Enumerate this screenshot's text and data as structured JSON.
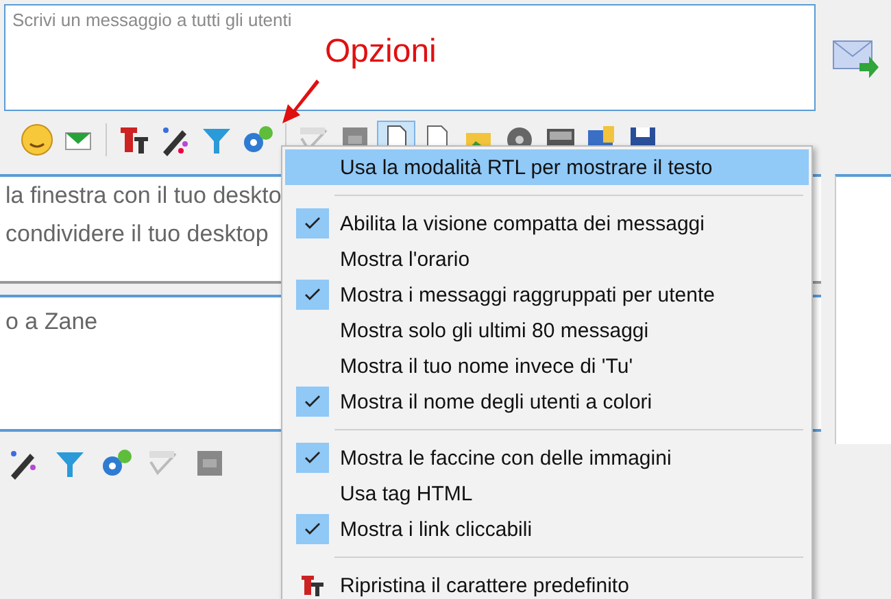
{
  "message_box": {
    "placeholder": "Scrivi un messaggio a tutti gli utenti"
  },
  "annotation": {
    "label": "Opzioni"
  },
  "chat_panel": {
    "lines": [
      "la finestra con il tuo deskto",
      "condividere il tuo desktop"
    ]
  },
  "private_panel": {
    "text": "o a Zane"
  },
  "menu": {
    "groups": [
      [
        {
          "kind": "check",
          "label": "Usa la modalità RTL per mostrare il testo",
          "checked": false,
          "selected": true
        }
      ],
      [
        {
          "kind": "check",
          "label": "Abilita la visione compatta dei messaggi",
          "checked": true,
          "selected": false
        },
        {
          "kind": "check",
          "label": "Mostra l'orario",
          "checked": false,
          "selected": false
        },
        {
          "kind": "check",
          "label": "Mostra i messaggi raggruppati per utente",
          "checked": true,
          "selected": false
        },
        {
          "kind": "check",
          "label": "Mostra solo gli ultimi 80 messaggi",
          "checked": false,
          "selected": false
        },
        {
          "kind": "check",
          "label": "Mostra il tuo nome invece di 'Tu'",
          "checked": false,
          "selected": false
        },
        {
          "kind": "check",
          "label": "Mostra il nome degli utenti a colori",
          "checked": true,
          "selected": false
        }
      ],
      [
        {
          "kind": "check",
          "label": "Mostra le faccine con delle immagini",
          "checked": true,
          "selected": false
        },
        {
          "kind": "check",
          "label": "Usa tag HTML",
          "checked": false,
          "selected": false
        },
        {
          "kind": "check",
          "label": "Mostra i link cliccabili",
          "checked": true,
          "selected": false
        }
      ],
      [
        {
          "kind": "command",
          "label": "Ripristina il carattere predefinito",
          "selected": false
        }
      ]
    ]
  }
}
